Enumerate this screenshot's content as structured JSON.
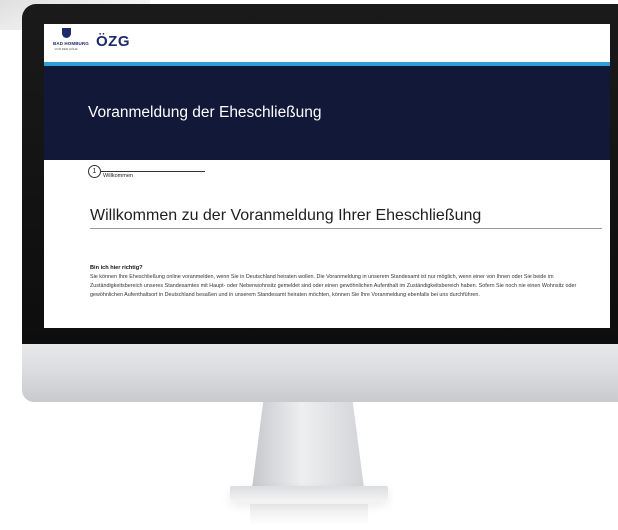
{
  "header": {
    "crest_title": "BAD HOMBURG",
    "crest_subtitle": "VOR DER HÖHE",
    "ozg_logo": "ÖZG",
    "accent_color": "#2f9fd8"
  },
  "hero": {
    "title": "Voranmeldung der Eheschließung",
    "background_color": "#121838"
  },
  "stepper": {
    "steps": [
      {
        "number": "1",
        "label": "Willkommen"
      }
    ]
  },
  "main": {
    "heading": "Willkommen zu der Voranmeldung Ihrer Eheschließung",
    "question": "Bin ich hier richtig?",
    "body": "Sie können Ihre Eheschließung online voranmelden, wenn Sie in Deutschland heiraten wollen. Die Voranmeldung in unserem Standesamt ist nur möglich, wenn einer von Ihnen oder Sie beide im Zuständigkeitsbereich unseres Standesamtes mit Haupt- oder Nebenwohnsitz gemeldet sind oder einen gewöhnlichen Aufenthalt im Zuständigkeitsbereich haben. Sofern Sie noch nie einen Wohnsitz oder gewöhnlichen Aufenthaltsort in Deutschland besaßen und in unserem Standesamt heiraten möchten, können Sie Ihre Voranmeldung ebenfalls bei uns durchführen."
  }
}
